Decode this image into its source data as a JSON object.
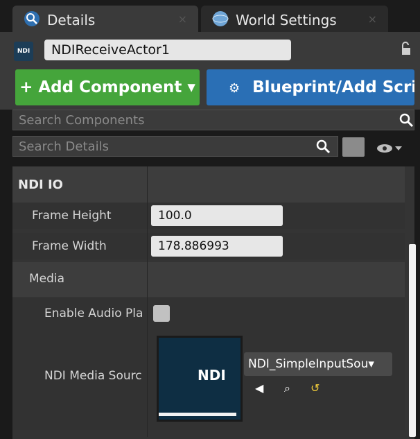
{
  "tabs": [
    {
      "label": "Details",
      "icon": "details-magnifier-icon",
      "active": true
    },
    {
      "label": "World Settings",
      "icon": "world-globe-icon",
      "active": false
    }
  ],
  "actor": {
    "badge": "NDI",
    "name": "NDIReceiveActor1"
  },
  "buttons": {
    "add_component": "+ Add Component ▾",
    "blueprint": "Blueprint/Add Scri"
  },
  "search": {
    "components_placeholder": "Search Components",
    "details_placeholder": "Search Details"
  },
  "sections": {
    "ndi_io": "NDI IO",
    "frame_height_label": "Frame Height",
    "frame_height_value": "100.0",
    "frame_width_label": "Frame Width",
    "frame_width_value": "178.886993",
    "media": "Media",
    "enable_audio_label": "Enable Audio Pla",
    "ndi_media_source_label": "NDI Media Sourc",
    "media_source_value": "NDI_SimpleInputSou▾",
    "thumbnail_text": "NDI"
  },
  "colors": {
    "accent_green": "#45a53b",
    "accent_blue": "#2a6fb5",
    "panel": "#343434"
  }
}
